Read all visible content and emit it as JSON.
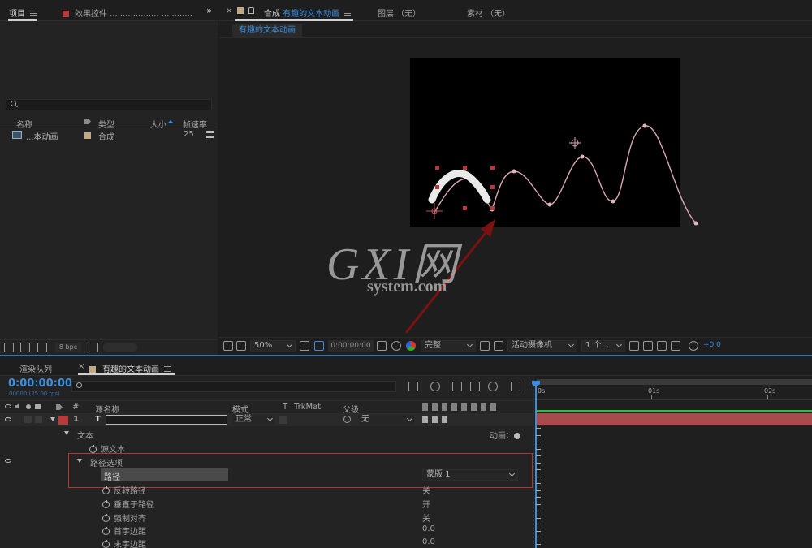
{
  "project_panel": {
    "tab_project": "项目",
    "tab_effects": "效果控件 ................... ... ........",
    "search_icon": "search-icon",
    "columns": {
      "name": "名称",
      "type": "类型",
      "size": "大小",
      "framerate": "帧速率"
    },
    "item": {
      "name": "...本动画",
      "type": "合成",
      "framerate": "25"
    },
    "bpc": "8 bpc"
  },
  "comp_panel": {
    "tab_prefix": "合成",
    "tab_name": "有趣的文本动画",
    "tab_layer": "图层 （无）",
    "tab_footage": "素材 （无）",
    "subtab": "有趣的文本动画"
  },
  "viewer_toolbar": {
    "zoom": "50%",
    "timecode": "0:00:00:00",
    "quality": "完整",
    "camera": "活动摄像机",
    "views": "1 个...",
    "exposure": "+0.0"
  },
  "watermark": {
    "logo_text": "GXI网",
    "sub": "system.com"
  },
  "timeline": {
    "tab_render": "渲染队列",
    "tab_comp": "有趣的文本动画",
    "timecode": "0:00:00:00",
    "fps": "00000 (25.00 fps)",
    "headers": {
      "num": "#",
      "source": "源名称",
      "mode": "模式",
      "t": "T",
      "trkmat": "TrkMat",
      "parent": "父级"
    },
    "layer": {
      "num": "1",
      "type": "T",
      "mode": "正常",
      "parent": "无"
    },
    "ruler": [
      "0s",
      "01s",
      "02s"
    ],
    "props": {
      "text": "文本",
      "animate": "动画：",
      "source_text": "源文本",
      "path_options": "路径选项",
      "path": "路径",
      "path_value": "蒙版 1",
      "reverse": "反转路径",
      "reverse_val": "关",
      "perp": "垂直于路径",
      "perp_val": "开",
      "force": "强制对齐",
      "force_val": "关",
      "first_margin": "首字边距",
      "first_val": "0.0",
      "last_margin": "末字边距",
      "last_val": "0.0"
    }
  }
}
